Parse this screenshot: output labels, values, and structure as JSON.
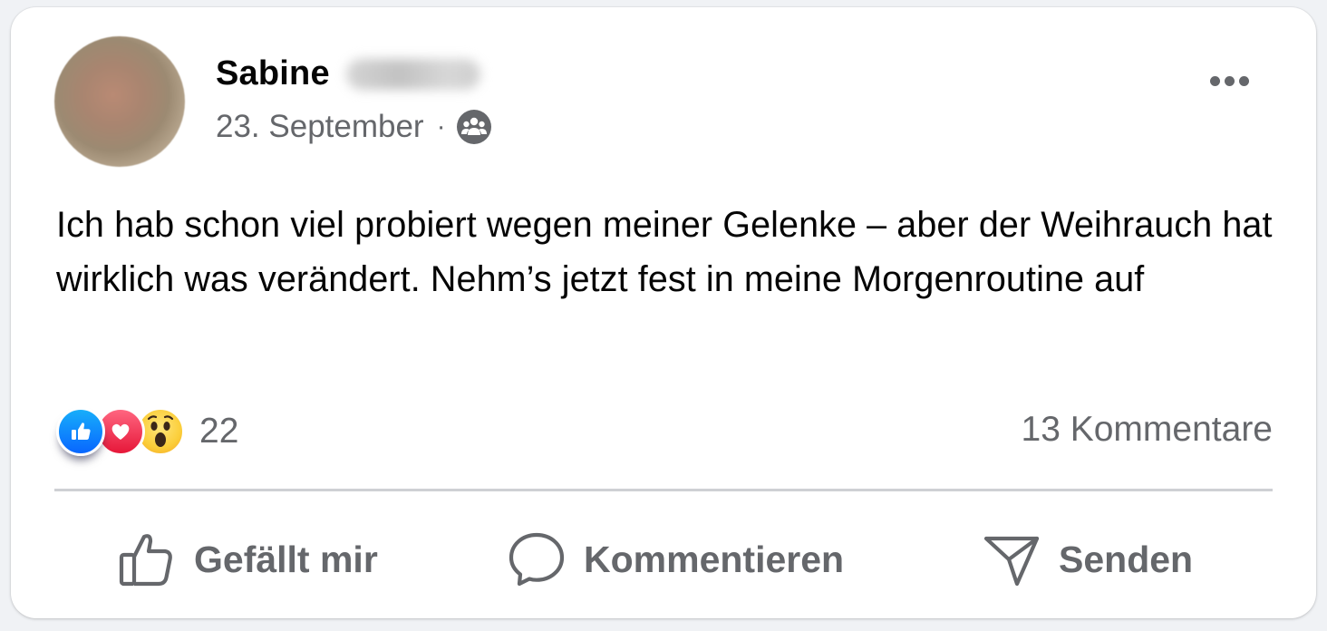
{
  "post": {
    "author_first_name": "Sabine",
    "date": "23. September",
    "separator": "·",
    "audience_icon": "group-icon",
    "text": "Ich hab schon viel probiert wegen meiner Gelenke – aber der Weihrauch hat wirklich was verändert. Nehm’s jetzt fest in meine Morgenroutine auf"
  },
  "reactions": {
    "types": [
      "like",
      "love",
      "wow"
    ],
    "count": "22"
  },
  "comments": {
    "label": "13 Kommentare"
  },
  "actions": {
    "like_label": "Gefällt mir",
    "comment_label": "Kommentieren",
    "share_label": "Senden"
  },
  "colors": {
    "text_primary": "#050505",
    "text_secondary": "#65676b",
    "like_blue": "#0866ff",
    "love_red": "#e61739",
    "wow_yellow": "#fbce3a",
    "divider": "#ced0d4"
  }
}
